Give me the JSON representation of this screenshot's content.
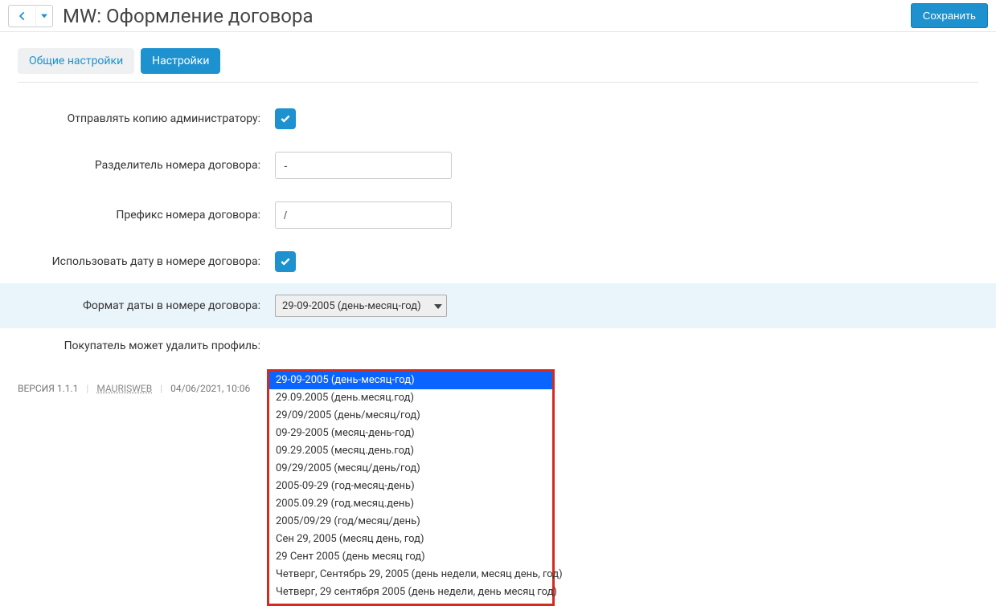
{
  "header": {
    "title": "MW: Оформление договора",
    "save_label": "Сохранить"
  },
  "tabs": [
    {
      "label": "Общие настройки",
      "active": false
    },
    {
      "label": "Настройки",
      "active": true
    }
  ],
  "form": {
    "send_copy_admin": {
      "label": "Отправлять копию администратору:"
    },
    "separator": {
      "label": "Разделитель номера договора:",
      "value": "-"
    },
    "prefix": {
      "label": "Префикс номера договора:",
      "value": "/"
    },
    "use_date": {
      "label": "Использовать дату в номере договора:"
    },
    "date_format": {
      "label": "Формат даты в номере договора:",
      "selected": "29-09-2005 (день-месяц-год)"
    },
    "buyer_delete": {
      "label": "Покупатель может удалить профиль:"
    }
  },
  "dropdown_options": [
    "29-09-2005 (день-месяц-год)",
    "29.09.2005 (день.месяц.год)",
    "29/09/2005 (день/месяц/год)",
    "09-29-2005 (месяц-день-год)",
    "09.29.2005 (месяц.день.год)",
    "09/29/2005 (месяц/день/год)",
    "2005-09-29 (год-месяц-день)",
    "2005.09.29 (год.месяц.день)",
    "2005/09/29 (год/месяц/день)",
    "Сен 29, 2005 (месяц день, год)",
    "29 Сент 2005 (день месяц год)",
    "Четверг, Сентябрь 29, 2005 (день недели, месяц день, год)",
    "Четверг, 29 сентября 2005 (день недели, день месяц год)"
  ],
  "footer": {
    "version": "ВЕРСИЯ 1.1.1",
    "link": "MAURISWEB",
    "timestamp": "04/06/2021, 10:06"
  }
}
